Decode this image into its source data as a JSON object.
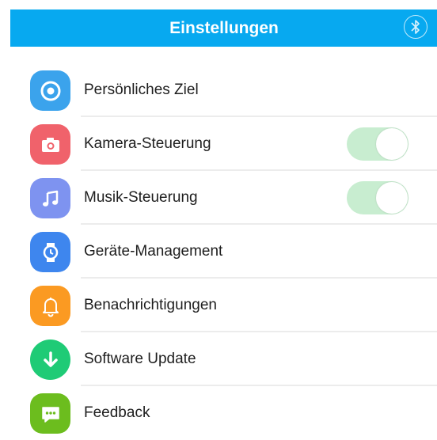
{
  "header": {
    "title": "Einstellungen",
    "action_icon": "bluetooth-icon"
  },
  "settings": {
    "items": [
      {
        "label": "Persönliches Ziel",
        "icon": "target-icon",
        "color": "#3ba3ec"
      },
      {
        "label": "Kamera-Steuerung",
        "icon": "camera-icon",
        "color": "#f0626b",
        "toggle": true
      },
      {
        "label": "Musik-Steuerung",
        "icon": "music-note-icon",
        "color": "#7e93f0",
        "toggle": true
      },
      {
        "label": "Geräte-Management",
        "icon": "watch-icon",
        "color": "#3e86ee"
      },
      {
        "label": "Benachrichtigungen",
        "icon": "bell-icon",
        "color": "#fb9a22"
      },
      {
        "label": "Software Update",
        "icon": "download-arrow-icon",
        "color": "#1fcb76"
      },
      {
        "label": "Feedback",
        "icon": "chat-bubble-icon",
        "color": "#6cbd1e"
      }
    ]
  },
  "colors": {
    "header_bg": "#07a9f0",
    "toggle_on": "#c8edd0"
  }
}
